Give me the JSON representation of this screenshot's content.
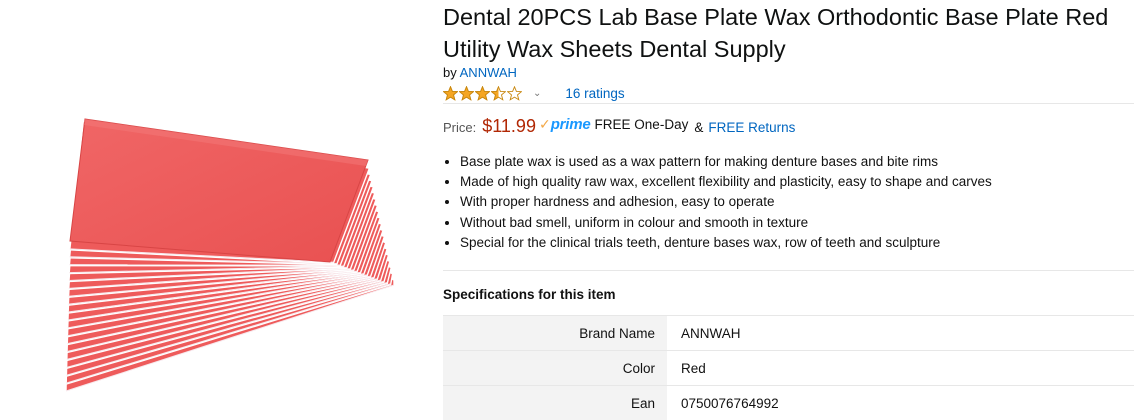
{
  "product": {
    "title": "Dental 20PCS Lab Base Plate Wax Orthodontic Base Plate Red Utility Wax Sheets Dental Supply",
    "by_prefix": "by",
    "brand": "ANNWAH",
    "rating_value": 3.5,
    "rating_max": 5,
    "ratings_count": "16 ratings",
    "image_icon": "red-wax-sheets-fan-image"
  },
  "price": {
    "label": "Price:",
    "value": "$11.99",
    "prime_check": "✓",
    "prime_word": "prime",
    "shipping": "FREE One-Day",
    "amp": "&",
    "returns": "FREE Returns"
  },
  "bullets": [
    "Base plate wax is used as a wax pattern for making denture bases and bite rims",
    "Made of high quality raw wax, excellent flexibility and plasticity, easy to shape and carves",
    "With proper hardness and adhesion, easy to operate",
    "Without bad smell, uniform in colour and smooth in texture",
    "Special for the clinical trials teeth, denture bases wax, row of teeth and sculpture"
  ],
  "specs": {
    "title": "Specifications for this item",
    "rows": [
      {
        "key": "Brand Name",
        "value": "ANNWAH"
      },
      {
        "key": "Color",
        "value": "Red"
      },
      {
        "key": "Ean",
        "value": "0750076764992"
      }
    ]
  },
  "colors": {
    "wax_red": "#ee5b5b",
    "price_red": "#b12704",
    "link_blue": "#0066c0",
    "prime_blue": "#1a98ff",
    "star_gold": "#f5a623"
  }
}
